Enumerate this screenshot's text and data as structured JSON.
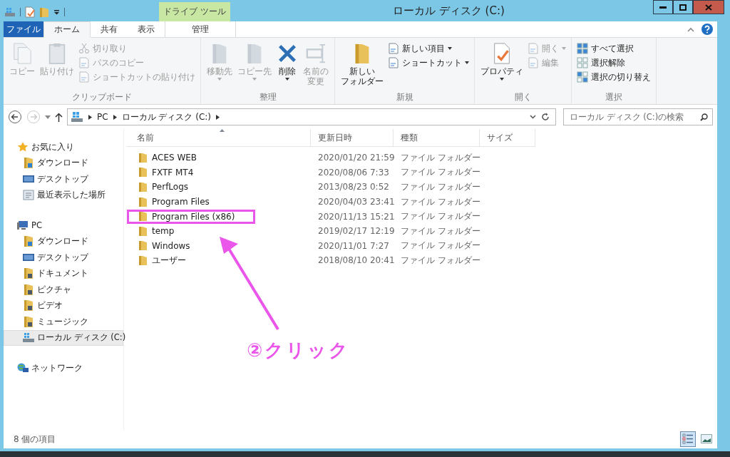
{
  "window": {
    "title": "ローカル ディスク (C:)",
    "context_tab": "ドライブ ツール"
  },
  "tabs": [
    {
      "label": "ファイル",
      "kind": "file",
      "selected": false
    },
    {
      "label": "ホーム",
      "kind": "tab",
      "selected": true
    },
    {
      "label": "共有",
      "kind": "tab",
      "selected": false
    },
    {
      "label": "表示",
      "kind": "tab",
      "selected": false
    },
    {
      "label": "管理",
      "kind": "context",
      "selected": false
    }
  ],
  "ribbon": [
    {
      "label": "クリップボード",
      "items": [
        {
          "kind": "large",
          "label": "コピー",
          "disabled": true
        },
        {
          "kind": "large",
          "label": "貼り付け",
          "disabled": true
        },
        {
          "kind": "stack",
          "items": [
            {
              "label": "切り取り",
              "disabled": true
            },
            {
              "label": "パスのコピー",
              "disabled": true
            },
            {
              "label": "ショートカットの貼り付け",
              "disabled": true
            }
          ]
        }
      ]
    },
    {
      "label": "整理",
      "items": [
        {
          "kind": "large",
          "label": "移動先",
          "disabled": true,
          "dropdown": true
        },
        {
          "kind": "large",
          "label": "コピー先",
          "disabled": true,
          "dropdown": true
        },
        {
          "kind": "large",
          "label": "削除",
          "disabled": false,
          "dropdown": true
        },
        {
          "kind": "large",
          "label": "名前の変更",
          "disabled": true
        }
      ]
    },
    {
      "label": "新規",
      "items": [
        {
          "kind": "large",
          "label": "新しいフォルダー",
          "disabled": false
        },
        {
          "kind": "stack",
          "items": [
            {
              "label": "新しい項目",
              "disabled": false,
              "dropdown": true
            },
            {
              "label": "ショートカット",
              "disabled": false,
              "dropdown": true
            }
          ]
        }
      ]
    },
    {
      "label": "開く",
      "items": [
        {
          "kind": "large",
          "label": "プロパティ",
          "disabled": false,
          "dropdown": true
        },
        {
          "kind": "stack",
          "items": [
            {
              "label": "開く",
              "disabled": true,
              "dropdown": true
            },
            {
              "label": "編集",
              "disabled": true
            }
          ]
        }
      ]
    },
    {
      "label": "選択",
      "items": [
        {
          "kind": "stack",
          "items": [
            {
              "label": "すべて選択",
              "disabled": false
            },
            {
              "label": "選択解除",
              "disabled": false
            },
            {
              "label": "選択の切り替え",
              "disabled": false
            }
          ]
        }
      ]
    }
  ],
  "address": {
    "path": [
      "PC",
      "ローカル ディスク (C:)"
    ]
  },
  "search": {
    "placeholder": "ローカル ディスク (C:)の検索"
  },
  "sidebar": [
    {
      "label": "お気に入り",
      "kind": "star",
      "selected": false,
      "children": [
        {
          "label": "ダウンロード",
          "kind": "download",
          "selected": false
        },
        {
          "label": "デスクトップ",
          "kind": "desktop",
          "selected": false
        },
        {
          "label": "最近表示した場所",
          "kind": "recent",
          "selected": false
        }
      ]
    },
    {
      "label": "PC",
      "kind": "pc",
      "selected": false,
      "children": [
        {
          "label": "ダウンロード",
          "kind": "download",
          "selected": false
        },
        {
          "label": "デスクトップ",
          "kind": "desktop",
          "selected": false
        },
        {
          "label": "ドキュメント",
          "kind": "library",
          "selected": false
        },
        {
          "label": "ピクチャ",
          "kind": "library",
          "selected": false
        },
        {
          "label": "ビデオ",
          "kind": "library",
          "selected": false
        },
        {
          "label": "ミュージック",
          "kind": "library",
          "selected": false
        },
        {
          "label": "ローカル ディスク (C:)",
          "kind": "drive",
          "selected": true
        }
      ]
    },
    {
      "label": "ネットワーク",
      "kind": "network",
      "selected": false
    }
  ],
  "table": {
    "columns": [
      "名前",
      "更新日時",
      "種類",
      "サイズ"
    ],
    "rows": [
      {
        "name": "ACES WEB",
        "date": "2020/01/20 21:59",
        "type": "ファイル フォルダー",
        "annotated": false
      },
      {
        "name": "FXTF MT4",
        "date": "2020/08/06 7:33",
        "type": "ファイル フォルダー",
        "annotated": false
      },
      {
        "name": "PerfLogs",
        "date": "2013/08/23 0:52",
        "type": "ファイル フォルダー",
        "annotated": false
      },
      {
        "name": "Program Files",
        "date": "2020/04/03 23:41",
        "type": "ファイル フォルダー",
        "annotated": false
      },
      {
        "name": "Program Files (x86)",
        "date": "2020/11/13 15:21",
        "type": "ファイル フォルダー",
        "annotated": true
      },
      {
        "name": "temp",
        "date": "2019/02/17 12:19",
        "type": "ファイル フォルダー",
        "annotated": false
      },
      {
        "name": "Windows",
        "date": "2020/11/01 7:27",
        "type": "ファイル フォルダー",
        "annotated": false
      },
      {
        "name": "ユーザー",
        "date": "2018/08/10 20:41",
        "type": "ファイル フォルダー",
        "annotated": false
      }
    ]
  },
  "annotation": {
    "text": "②クリック"
  },
  "status_bar": {
    "text": "8 個の項目",
    "views": [
      {
        "kind": "details",
        "selected": true
      },
      {
        "kind": "large-icons",
        "selected": false
      }
    ]
  }
}
